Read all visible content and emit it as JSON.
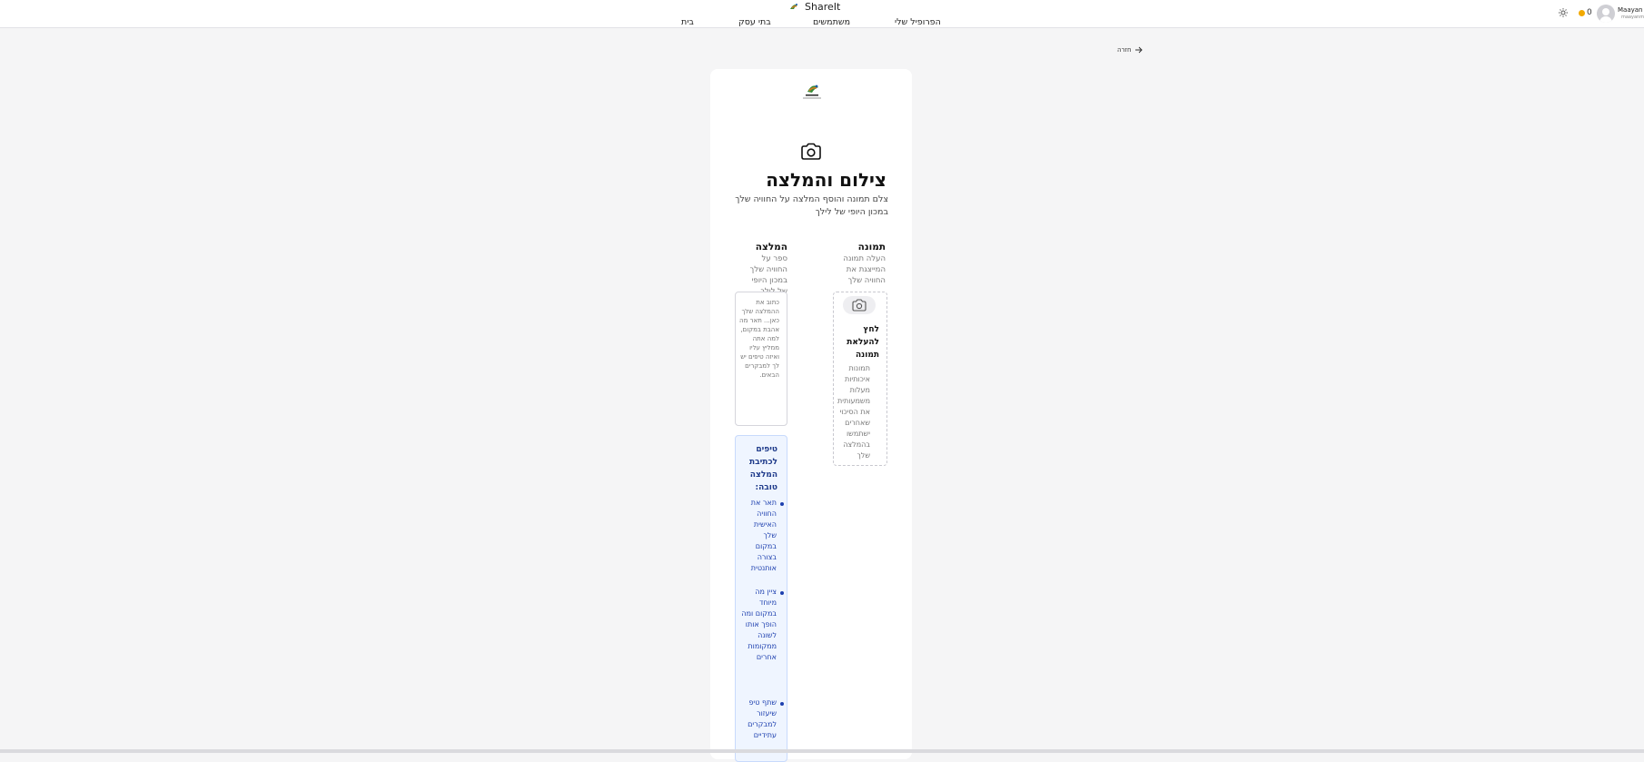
{
  "header": {
    "app_title": "ShareIt",
    "nav": [
      "הפרופיל שלי",
      "משתמשים",
      "בתי עסק",
      "בית"
    ],
    "coins": "0",
    "user_name": "Maayan M",
    "user_email": "maayanm"
  },
  "back_label": "חזרה",
  "card": {
    "title": "צילום והמלצה",
    "subtitle": "צלם תמונה והוסף המלצה על החוויה שלך במכון היופי של לילך",
    "photo_section": {
      "title": "תמונה",
      "desc": "העלה תמונה המייצגת את החוויה שלך",
      "upload_title": "לחץ להעלאת תמונה",
      "upload_desc": "תמונות איכותיות מעלות משמעותית את הסיכוי שאחרים ישתמשו בהמלצה שלך"
    },
    "review_section": {
      "title": "המלצה",
      "desc": "ספר על החוויה שלך במכון היופי של לילך",
      "placeholder": "כתוב את ההמלצה שלך כאן... תאר מה אהבת במקום, למה אתה ממליץ עליו ואיזה טיפים יש לך למבקרים הבאים."
    },
    "tips": {
      "title": "טיפים לכתיבת המלצה טובה:",
      "items": [
        "תאר את החוויה האישית שלך במקום בצורה אותנטית",
        "ציין מה מיוחד במקום ומה הופך אותו לשונה ממקומות אחרים",
        "שתף טיפ שיעזור למבקרים עתידיים"
      ]
    }
  },
  "colors": {
    "accent": "#1e40af",
    "tips_bg": "#eff5ff",
    "coin": "#f2a900"
  }
}
